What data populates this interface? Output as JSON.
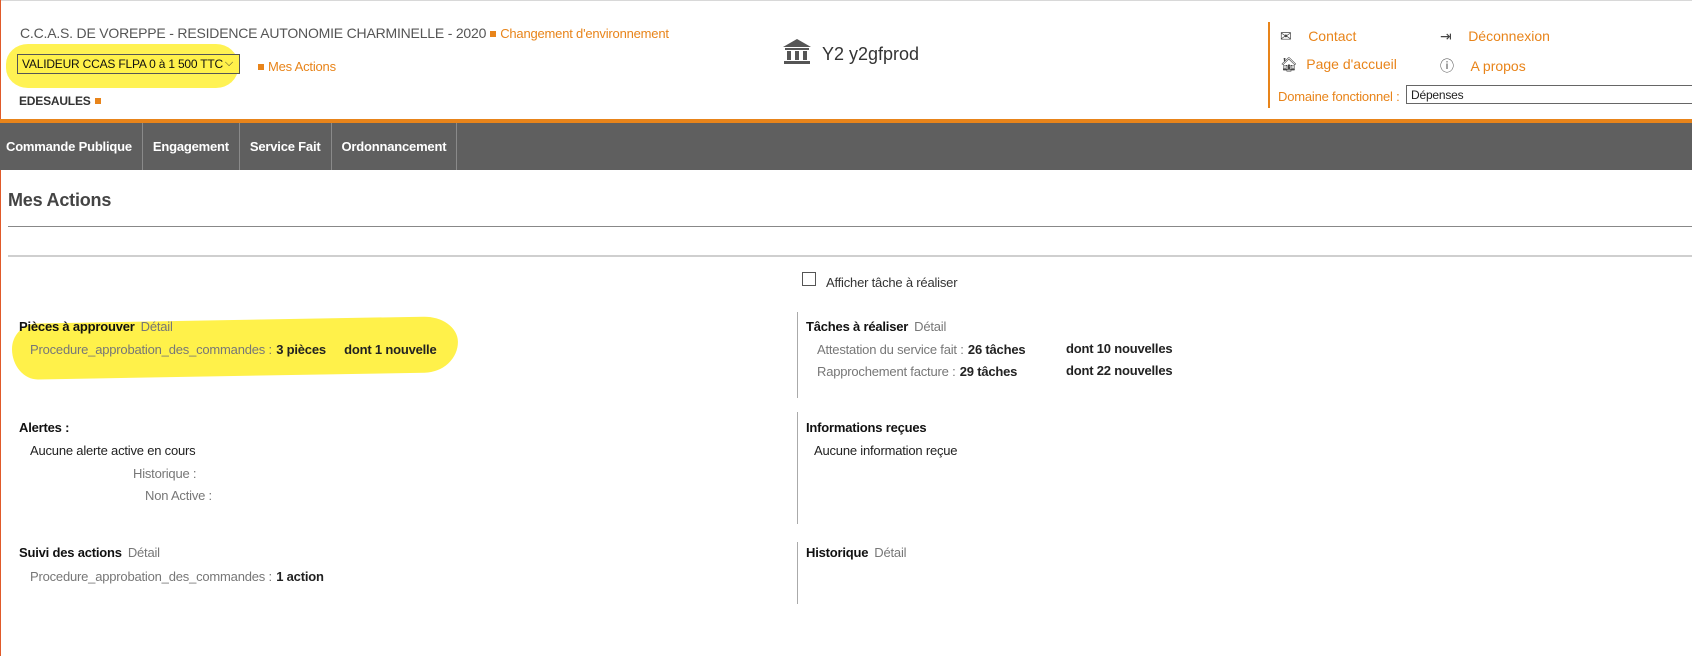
{
  "header": {
    "org_title": "C.C.A.S. DE VOREPPE - RESIDENCE AUTONOMIE CHARMINELLE - 2020",
    "change_env_link": "Changement d'environnement",
    "role_select_value": "VALIDEUR CCAS FLPA 0 à 1 500 TTC",
    "mes_actions_link": "Mes Actions",
    "user_name": "EDESAULES",
    "env_label": "Y2 y2gfprod",
    "links": {
      "contact": "Contact",
      "accueil": "Page d'accueil",
      "deconnexion": "Déconnexion",
      "apropos": "A propos"
    },
    "domaine_label": "Domaine fonctionnel :",
    "domaine_value": "Dépenses"
  },
  "nav": [
    "Commande Publique",
    "Engagement",
    "Service Fait",
    "Ordonnancement"
  ],
  "page_title": "Mes Actions",
  "checkbox_label": "Afficher tâche à réaliser",
  "pieces": {
    "title": "Pièces à approuver",
    "detail": "Détail",
    "proc": "Procedure_approbation_des_commandes :",
    "count": "3 pièces",
    "new": "dont 1 nouvelle"
  },
  "taches": {
    "title": "Tâches à réaliser",
    "detail": "Détail",
    "rows": [
      {
        "label": "Attestation du service fait :",
        "count": "26 tâches",
        "new": "dont 10 nouvelles"
      },
      {
        "label": "Rapprochement facture :",
        "count": "29 tâches",
        "new": "dont 22 nouvelles"
      }
    ]
  },
  "alertes": {
    "title": "Alertes :",
    "none": "Aucune alerte active en cours",
    "historique": "Historique :",
    "non_active": "Non Active :"
  },
  "infos": {
    "title": "Informations reçues",
    "none": "Aucune information reçue"
  },
  "suivi": {
    "title": "Suivi des actions",
    "detail": "Détail",
    "proc": "Procedure_approbation_des_commandes :",
    "count": "1 action"
  },
  "historique": {
    "title": "Historique",
    "detail": "Détail"
  },
  "colors": {
    "accent": "#e8841a",
    "nav_bg": "#5f5f5f",
    "highlight": "#fff14a"
  }
}
